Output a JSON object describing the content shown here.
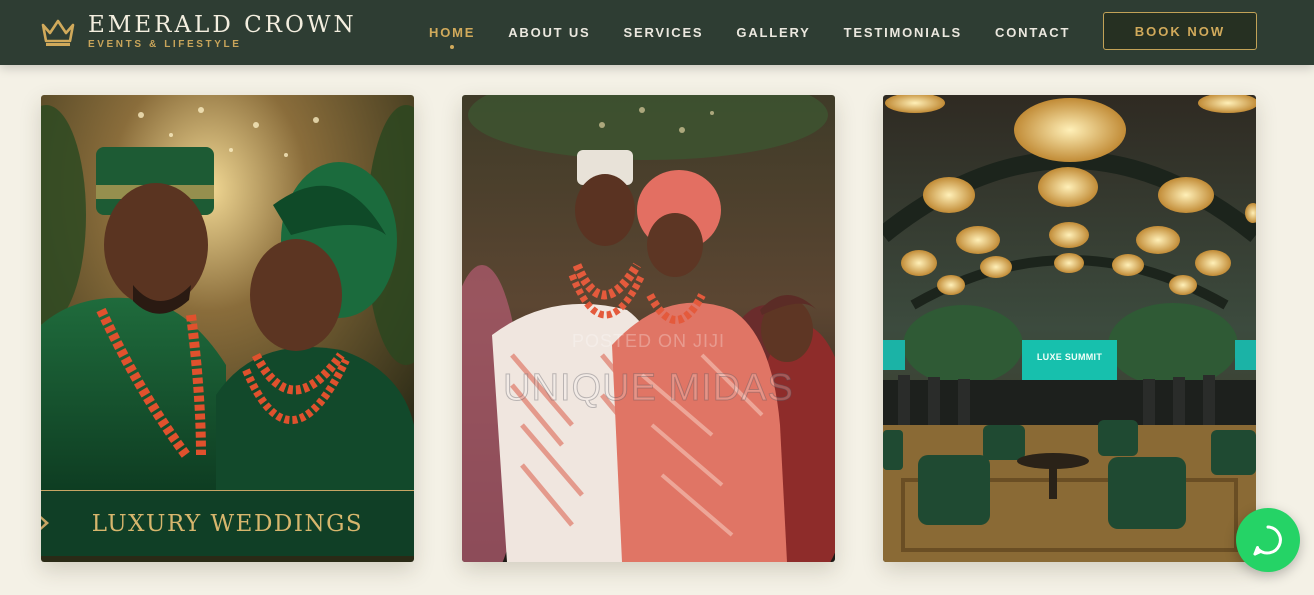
{
  "brand": {
    "name": "EMERALD CROWN",
    "tagline": "EVENTS & LIFESTYLE",
    "logo_icon": "crown-icon"
  },
  "nav": {
    "items": [
      {
        "label": "HOME",
        "active": true
      },
      {
        "label": "ABOUT US",
        "active": false
      },
      {
        "label": "SERVICES",
        "active": false
      },
      {
        "label": "GALLERY",
        "active": false
      },
      {
        "label": "TESTIMONIALS",
        "active": false
      },
      {
        "label": "CONTACT",
        "active": false
      }
    ],
    "cta_label": "BOOK NOW"
  },
  "gallery": {
    "cards": [
      {
        "banner": "LUXURY WEDDINGS",
        "subject": "couple in green traditional attire"
      },
      {
        "watermark_small": "POSTED ON JIJI",
        "watermark_large": "UNIQUE MIDAS",
        "subject": "couple in coral traditional attire"
      },
      {
        "screen_text": "LUXE SUMMIT",
        "subject": "event hall with chandeliers"
      }
    ]
  },
  "floating": {
    "whatsapp_icon": "whatsapp-icon"
  },
  "colors": {
    "header_bg": "#2e3d33",
    "accent_gold": "#d1aa5b",
    "page_bg": "#f4f1e6",
    "emerald": "#103f26",
    "whatsapp": "#25d366"
  }
}
